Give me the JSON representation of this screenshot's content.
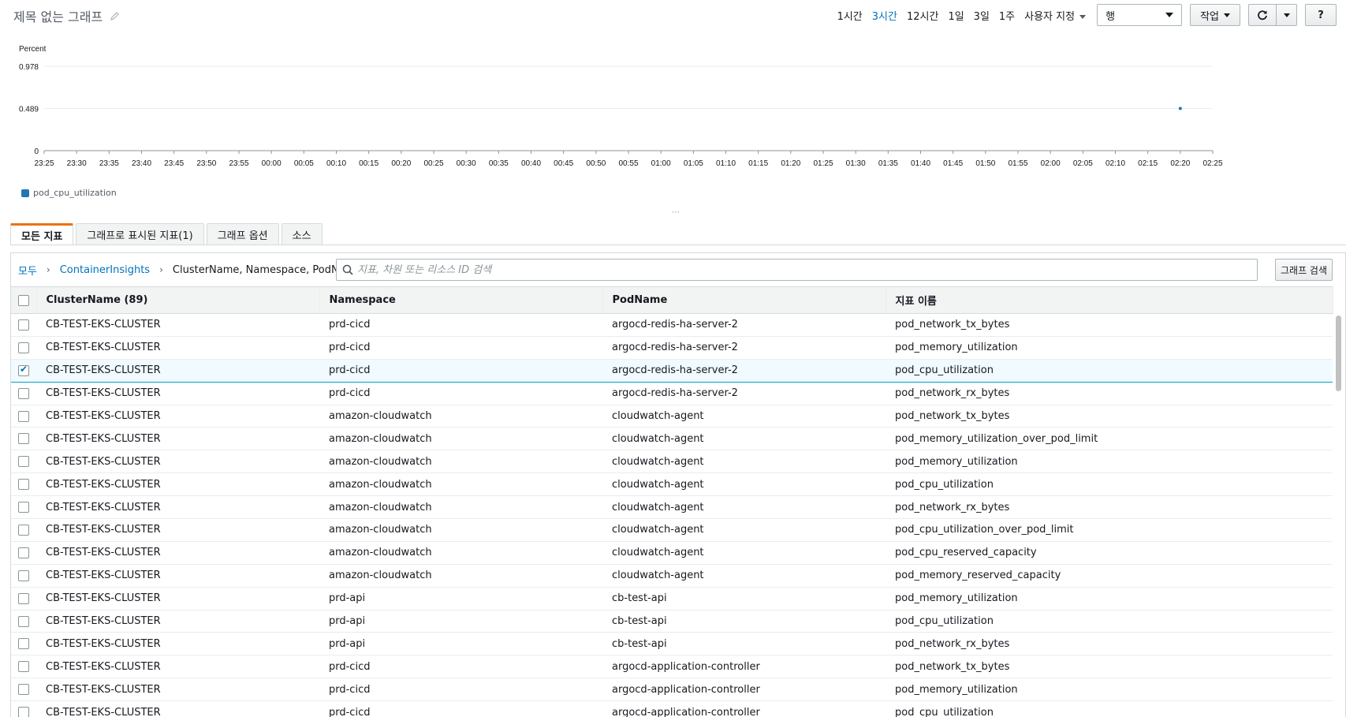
{
  "header": {
    "title": "제목 없는 그래프",
    "time_ranges": [
      {
        "label": "1시간",
        "active": false
      },
      {
        "label": "3시간",
        "active": true
      },
      {
        "label": "12시간",
        "active": false
      },
      {
        "label": "1일",
        "active": false
      },
      {
        "label": "3일",
        "active": false
      },
      {
        "label": "1주",
        "active": false
      }
    ],
    "custom_label": "사용자 지정",
    "view_select_value": "행",
    "actions_label": "작업",
    "help_label": "?"
  },
  "chart_data": {
    "type": "line",
    "ylabel": "Percent",
    "yticks": [
      "0",
      "0.489",
      "0.978"
    ],
    "ylim": [
      0,
      0.978
    ],
    "x_ticks": [
      "23:25",
      "23:30",
      "23:35",
      "23:40",
      "23:45",
      "23:50",
      "23:55",
      "00:00",
      "00:05",
      "00:10",
      "00:15",
      "00:20",
      "00:25",
      "00:30",
      "00:35",
      "00:40",
      "00:45",
      "00:50",
      "00:55",
      "01:00",
      "01:05",
      "01:10",
      "01:15",
      "01:20",
      "01:25",
      "01:30",
      "01:35",
      "01:40",
      "01:45",
      "01:50",
      "01:55",
      "02:00",
      "02:05",
      "02:10",
      "02:15",
      "02:20",
      "02:25"
    ],
    "series": [
      {
        "name": "pod_cpu_utilization",
        "color": "#1f77b4",
        "points": [
          {
            "x": "02:20",
            "y": 0.489
          }
        ]
      }
    ],
    "legend_position": "bottom-left",
    "grid": true
  },
  "tabs": [
    "모든 지표",
    "그래프로 표시된 지표(1)",
    "그래프 옵션",
    "소스"
  ],
  "breadcrumb": {
    "all": "모두",
    "namespace": "ContainerInsights",
    "dimensions": "ClusterName, Namespace, PodName"
  },
  "search": {
    "placeholder": "지표, 차원 또는 리소스 ID 검색"
  },
  "graph_search_label": "그래프 검색",
  "table": {
    "columns": [
      "ClusterName  (89)",
      "Namespace",
      "PodName",
      "지표 이름"
    ],
    "rows": [
      {
        "checked": false,
        "cells": [
          "CB-TEST-EKS-CLUSTER",
          "prd-cicd",
          "argocd-redis-ha-server-2",
          "pod_network_tx_bytes"
        ]
      },
      {
        "checked": false,
        "cells": [
          "CB-TEST-EKS-CLUSTER",
          "prd-cicd",
          "argocd-redis-ha-server-2",
          "pod_memory_utilization"
        ]
      },
      {
        "checked": true,
        "cells": [
          "CB-TEST-EKS-CLUSTER",
          "prd-cicd",
          "argocd-redis-ha-server-2",
          "pod_cpu_utilization"
        ]
      },
      {
        "checked": false,
        "cells": [
          "CB-TEST-EKS-CLUSTER",
          "prd-cicd",
          "argocd-redis-ha-server-2",
          "pod_network_rx_bytes"
        ]
      },
      {
        "checked": false,
        "cells": [
          "CB-TEST-EKS-CLUSTER",
          "amazon-cloudwatch",
          "cloudwatch-agent",
          "pod_network_tx_bytes"
        ]
      },
      {
        "checked": false,
        "cells": [
          "CB-TEST-EKS-CLUSTER",
          "amazon-cloudwatch",
          "cloudwatch-agent",
          "pod_memory_utilization_over_pod_limit"
        ]
      },
      {
        "checked": false,
        "cells": [
          "CB-TEST-EKS-CLUSTER",
          "amazon-cloudwatch",
          "cloudwatch-agent",
          "pod_memory_utilization"
        ]
      },
      {
        "checked": false,
        "cells": [
          "CB-TEST-EKS-CLUSTER",
          "amazon-cloudwatch",
          "cloudwatch-agent",
          "pod_cpu_utilization"
        ]
      },
      {
        "checked": false,
        "cells": [
          "CB-TEST-EKS-CLUSTER",
          "amazon-cloudwatch",
          "cloudwatch-agent",
          "pod_network_rx_bytes"
        ]
      },
      {
        "checked": false,
        "cells": [
          "CB-TEST-EKS-CLUSTER",
          "amazon-cloudwatch",
          "cloudwatch-agent",
          "pod_cpu_utilization_over_pod_limit"
        ]
      },
      {
        "checked": false,
        "cells": [
          "CB-TEST-EKS-CLUSTER",
          "amazon-cloudwatch",
          "cloudwatch-agent",
          "pod_cpu_reserved_capacity"
        ]
      },
      {
        "checked": false,
        "cells": [
          "CB-TEST-EKS-CLUSTER",
          "amazon-cloudwatch",
          "cloudwatch-agent",
          "pod_memory_reserved_capacity"
        ]
      },
      {
        "checked": false,
        "cells": [
          "CB-TEST-EKS-CLUSTER",
          "prd-api",
          "cb-test-api",
          "pod_memory_utilization"
        ]
      },
      {
        "checked": false,
        "cells": [
          "CB-TEST-EKS-CLUSTER",
          "prd-api",
          "cb-test-api",
          "pod_cpu_utilization"
        ]
      },
      {
        "checked": false,
        "cells": [
          "CB-TEST-EKS-CLUSTER",
          "prd-api",
          "cb-test-api",
          "pod_network_rx_bytes"
        ]
      },
      {
        "checked": false,
        "cells": [
          "CB-TEST-EKS-CLUSTER",
          "prd-cicd",
          "argocd-application-controller",
          "pod_network_tx_bytes"
        ]
      },
      {
        "checked": false,
        "cells": [
          "CB-TEST-EKS-CLUSTER",
          "prd-cicd",
          "argocd-application-controller",
          "pod_memory_utilization"
        ]
      },
      {
        "checked": false,
        "cells": [
          "CB-TEST-EKS-CLUSTER",
          "prd-cicd",
          "argocd-application-controller",
          "pod_cpu_utilization"
        ]
      }
    ]
  }
}
